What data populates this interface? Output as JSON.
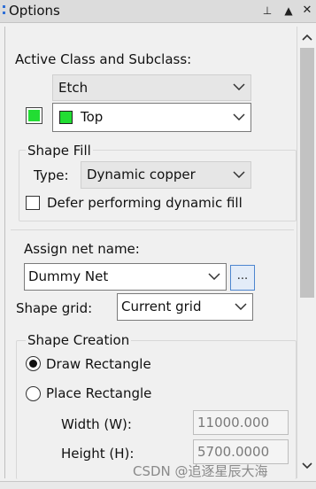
{
  "title": "Options",
  "titlebar_buttons": {
    "pin": "⊥",
    "up": "▲",
    "close": "✕"
  },
  "active_class": {
    "heading": "Active Class and Subclass:",
    "class_value": "Etch",
    "subclass_value": "Top",
    "color": "#22dd33"
  },
  "shape_fill": {
    "group_title": "Shape Fill",
    "type_label": "Type:",
    "type_value": "Dynamic copper",
    "defer_label": "Defer performing dynamic fill",
    "defer_checked": false
  },
  "net": {
    "label": "Assign net name:",
    "value": "Dummy Net",
    "browse_label": "..."
  },
  "grid": {
    "label": "Shape grid:",
    "value": "Current grid"
  },
  "shape_creation": {
    "group_title": "Shape Creation",
    "draw_rect_label": "Draw Rectangle",
    "place_rect_label": "Place Rectangle",
    "selected": "Draw Rectangle",
    "width_label": "Width (W):",
    "width_value": "11000.000",
    "height_label": "Height (H):",
    "height_value": "5700.0000"
  },
  "watermark": "CSDN @追逐星辰大海"
}
